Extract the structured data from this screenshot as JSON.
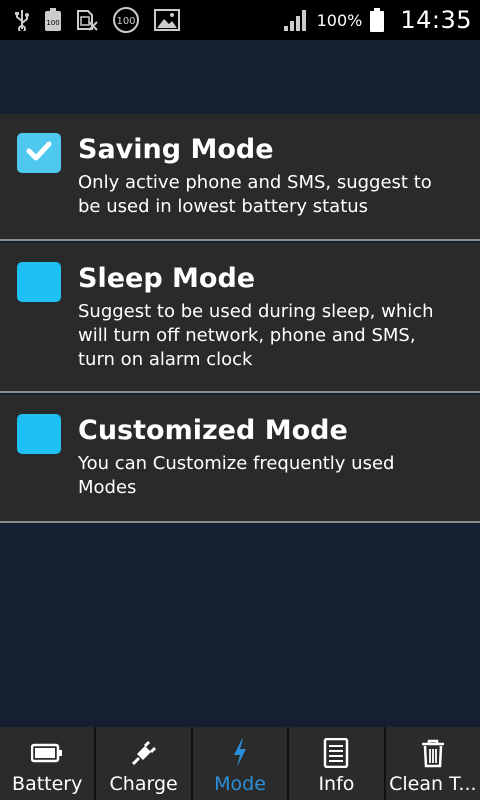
{
  "status_bar": {
    "icons": [
      "usb-icon",
      "battery-100-icon",
      "sim-off-icon",
      "badge-100-icon",
      "image-icon",
      "signal-icon"
    ],
    "badge_text": "100",
    "mini_battery_text": "100",
    "battery_percent": "100%",
    "time": "14:35"
  },
  "modes": [
    {
      "title": "Saving Mode",
      "description": "Only active phone and SMS, suggest to be used in lowest battery status",
      "checked": true
    },
    {
      "title": "Sleep Mode",
      "description": "Suggest to be used during sleep, which will turn off network, phone and SMS, turn on alarm clock",
      "checked": false
    },
    {
      "title": "Customized Mode",
      "description": "You can Customize frequently used Modes",
      "checked": false
    }
  ],
  "tabs": [
    {
      "label": "Battery",
      "icon": "battery-icon",
      "active": false
    },
    {
      "label": "Charge",
      "icon": "plug-icon",
      "active": false
    },
    {
      "label": "Mode",
      "icon": "lightning-icon",
      "active": true
    },
    {
      "label": "Info",
      "icon": "document-icon",
      "active": false
    },
    {
      "label": "Clean T...",
      "icon": "trash-icon",
      "active": false
    }
  ],
  "colors": {
    "background": "#142030",
    "card": "#2a2a2a",
    "checkbox": "#1ec0f4",
    "active_tab": "#2a8fd8",
    "tabbar": "#2b2b2b"
  }
}
